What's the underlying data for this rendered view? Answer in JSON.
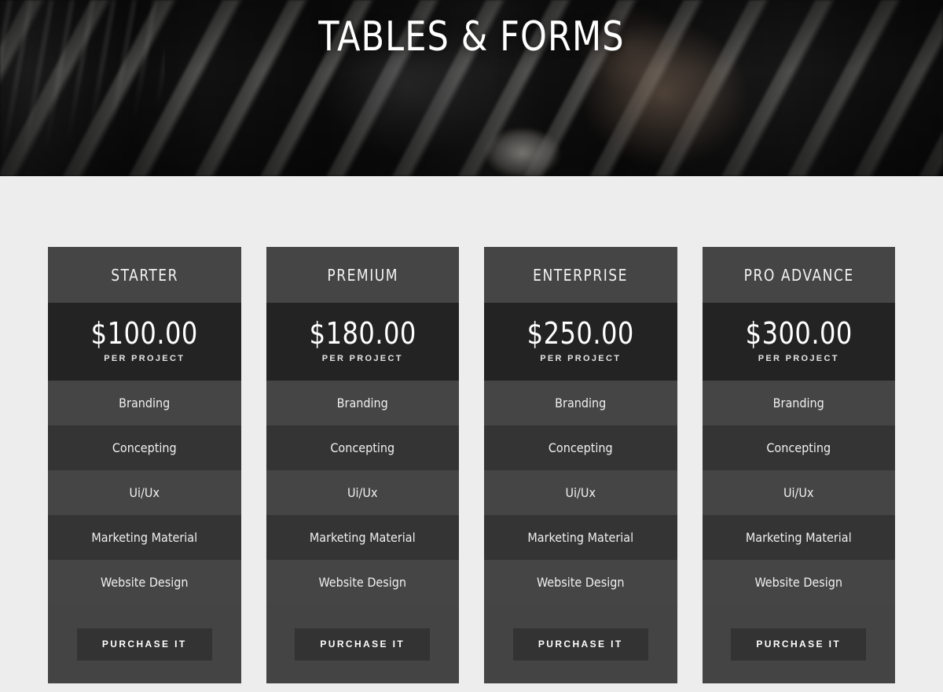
{
  "hero": {
    "title": "TABLES & FORMS",
    "background_image": "dark-blurred-workspace-person-with-glasses-photo"
  },
  "colors": {
    "page_background": "#ededed",
    "card_background": "#444444",
    "card_header_background": "#454545",
    "price_background": "#232323",
    "feature_row_light": "#454545",
    "feature_row_dark": "#343434",
    "button_background": "#333333",
    "text": "#ffffff"
  },
  "pricing": {
    "period_label": "PER PROJECT",
    "button_label": "PURCHASE IT",
    "plans": [
      {
        "name": "STARTER",
        "price": "$100.00",
        "period": "PER PROJECT",
        "features": [
          "Branding",
          "Concepting",
          "Ui/Ux",
          "Marketing Material",
          "Website Design"
        ],
        "button_label": "PURCHASE IT"
      },
      {
        "name": "PREMIUM",
        "price": "$180.00",
        "period": "PER PROJECT",
        "features": [
          "Branding",
          "Concepting",
          "Ui/Ux",
          "Marketing Material",
          "Website Design"
        ],
        "button_label": "PURCHASE IT"
      },
      {
        "name": "ENTERPRISE",
        "price": "$250.00",
        "period": "PER PROJECT",
        "features": [
          "Branding",
          "Concepting",
          "Ui/Ux",
          "Marketing Material",
          "Website Design"
        ],
        "button_label": "PURCHASE IT"
      },
      {
        "name": "PRO ADVANCE",
        "price": "$300.00",
        "period": "PER PROJECT",
        "features": [
          "Branding",
          "Concepting",
          "Ui/Ux",
          "Marketing Material",
          "Website Design"
        ],
        "button_label": "PURCHASE IT"
      }
    ]
  }
}
